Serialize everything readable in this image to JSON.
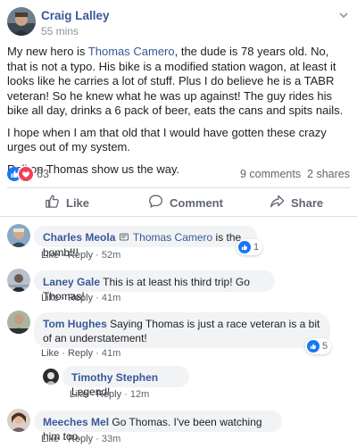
{
  "post": {
    "author": "Craig Lalley",
    "time": "55 mins",
    "paragraph1_pre": "My new hero is ",
    "paragraph1_link": "Thomas Camero",
    "paragraph1_post": ", the dude is 78 years old. No, that is not a typo. His bike is a modified station wagon, at least it looks like he carries a lot of stuff. Plus I do believe he is a TABR veteran! So he knew what he was up against! The guy rides his bike all day, drinks a 6 pack of beer, eats the cans and spits nails.",
    "paragraph2": "I hope when I am that old that I would have gotten these crazy urges out of my system.",
    "paragraph3": "Roll on Thomas show us the way.",
    "reaction_count": "63",
    "comments_count": "9 comments",
    "shares_count": "2 shares"
  },
  "actions": {
    "like": "Like",
    "comment": "Comment",
    "share": "Share"
  },
  "comments": [
    {
      "name": "Charles Meola",
      "tag": "Thomas Camero",
      "text": " is the bomb!!!",
      "like": "Like",
      "reply": "Reply",
      "age": "52m",
      "reactions": "1"
    },
    {
      "name": "Laney Gale",
      "text": "This is at least his third trip! Go Thomas!",
      "like": "Like",
      "reply": "Reply",
      "age": "41m"
    },
    {
      "name": "Tom Hughes",
      "text": "Saying Thomas is just a race veteran is a bit of an understatement!",
      "like": "Like",
      "reply": "Reply",
      "age": "41m",
      "reactions": "5"
    },
    {
      "name": "Timothy Stephen",
      "text": "Legend!",
      "like": "Like",
      "reply": "Reply",
      "age": "12m"
    },
    {
      "name": "Meeches Mel",
      "text": "Go Thomas. I've been watching him too.",
      "like": "Like",
      "reply": "Reply",
      "age": "33m"
    }
  ],
  "colors": {
    "link": "#385898",
    "like_blue": "#1877f2",
    "love_red": "#f33e58",
    "bubble": "#f2f3f5"
  },
  "icons": [
    "chevron-down-icon",
    "like-reaction-icon",
    "love-reaction-icon",
    "thumbs-up-icon",
    "comment-icon",
    "share-icon",
    "tag-icon"
  ]
}
